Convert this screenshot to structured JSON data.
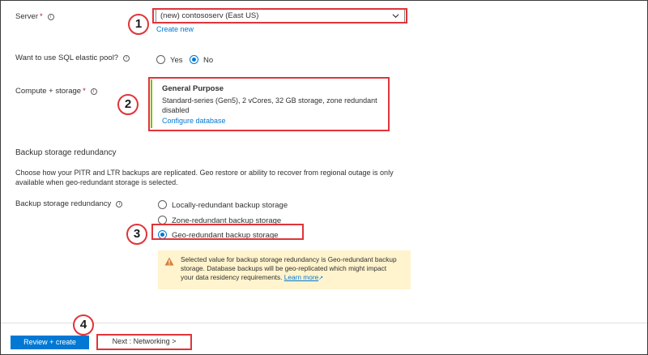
{
  "server": {
    "label": "Server",
    "value": "(new) contososerv (East US)",
    "create_link": "Create new"
  },
  "elastic_pool": {
    "label": "Want to use SQL elastic pool?",
    "options": [
      "Yes",
      "No"
    ],
    "selected": "No"
  },
  "compute": {
    "label": "Compute + storage",
    "tier": "General Purpose",
    "detail_line1": "Standard-series (Gen5), 2 vCores, 32 GB storage, zone redundant",
    "detail_line2": "disabled",
    "configure_link": "Configure database"
  },
  "backup": {
    "section_title": "Backup storage redundancy",
    "description_line1": "Choose how your PITR and LTR backups are replicated. Geo restore or ability to recover from regional outage is only",
    "description_line2": "available when geo-redundant storage is selected.",
    "label": "Backup storage redundancy",
    "options": [
      "Locally-redundant backup storage",
      "Zone-redundant backup storage",
      "Geo-redundant backup storage"
    ],
    "selected": "Geo-redundant backup storage"
  },
  "warning": {
    "line1": "Selected value for backup storage redundancy is Geo-redundant backup",
    "line2": "storage. Database backups will be geo-replicated which might impact",
    "line3": "your data residency requirements.",
    "learn_more": "Learn more"
  },
  "buttons": {
    "review_create": "Review + create",
    "next": "Next : Networking >"
  },
  "callouts": [
    "1",
    "2",
    "3",
    "4"
  ],
  "colors": {
    "accent": "#0078d4",
    "callout_red": "#e0343a",
    "required_red": "#a4262c",
    "tier_bar_green": "#7fba00",
    "warning_bg": "#fff4ce",
    "warning_icon": "#d67f3c"
  }
}
